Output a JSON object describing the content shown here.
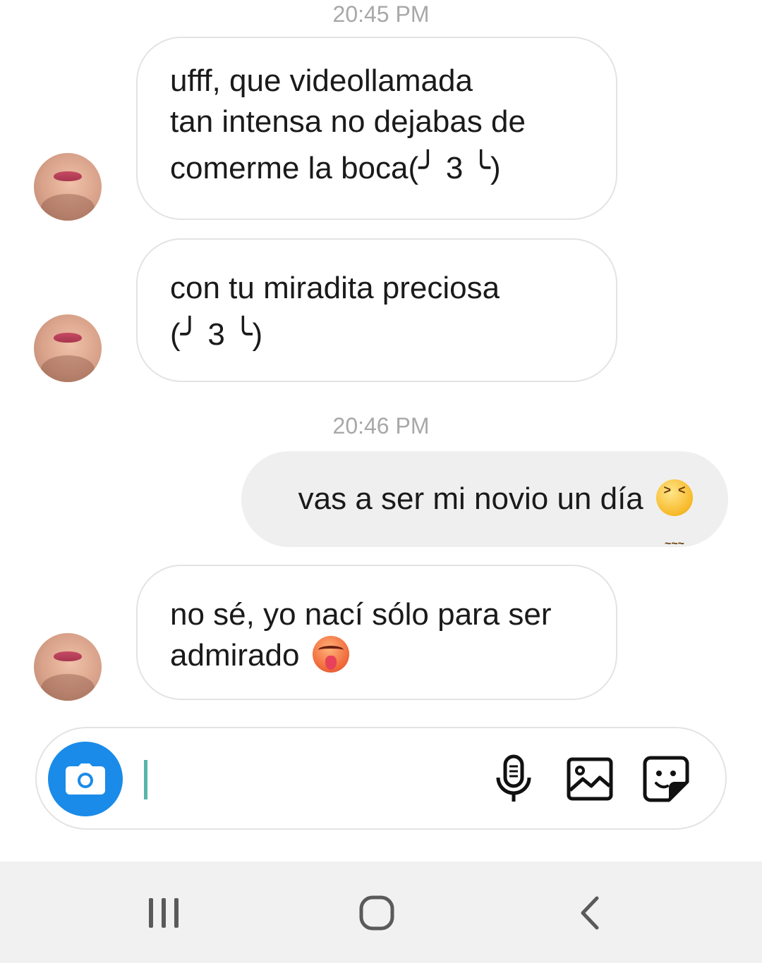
{
  "conversation": {
    "timestamps": [
      "20:45 PM",
      "20:46 PM"
    ],
    "messages": [
      {
        "direction": "incoming",
        "lines": [
          "ufff, que videollamada",
          "tan intensa no dejabas de",
          "comerme la boca(╯ 3 ╰)"
        ]
      },
      {
        "direction": "incoming",
        "lines": [
          "con tu miradita preciosa",
          "(╯ 3 ╰)"
        ]
      },
      {
        "direction": "outgoing",
        "text": "vas a ser mi novio un día ",
        "emoji": "confounded-face-emoji"
      },
      {
        "direction": "incoming",
        "lines": [
          "no sé, yo nací sólo para ser",
          "admirado "
        ],
        "emoji": "hot-face-emoji"
      }
    ]
  },
  "composer": {
    "input_value": "",
    "icons": [
      "camera-icon",
      "microphone-icon",
      "gallery-icon",
      "sticker-icon"
    ],
    "accent_color": "#1a8be8",
    "cursor_color": "#57b6a9"
  },
  "navbar": {
    "icons": [
      "recent-apps-icon",
      "home-icon",
      "back-icon"
    ]
  }
}
